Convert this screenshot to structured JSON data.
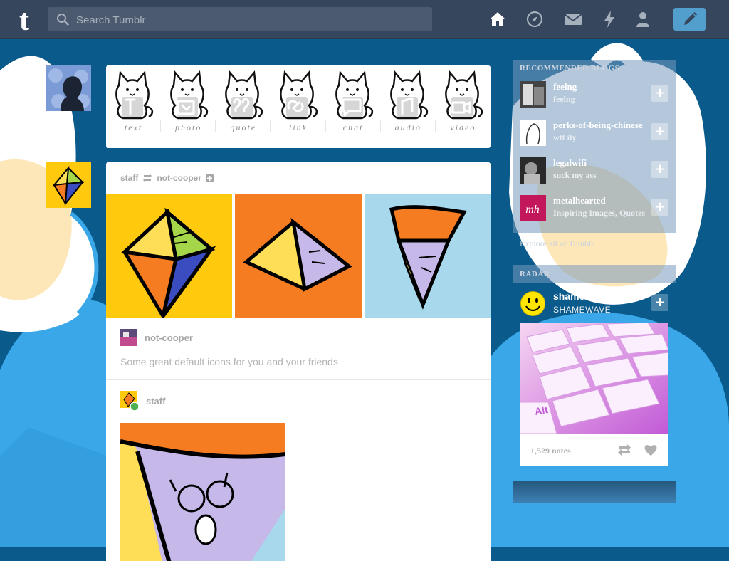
{
  "header": {
    "logo_text": "t",
    "search_placeholder": "Search Tumblr",
    "nav_icons": [
      "home-icon",
      "compass-icon",
      "mail-icon",
      "lightning-icon",
      "account-icon"
    ],
    "compose_icon": "pencil-icon",
    "accent": "#529ecc",
    "bar_color": "#36465d"
  },
  "composer": {
    "types": [
      {
        "label": "text"
      },
      {
        "label": "photo"
      },
      {
        "label": "quote"
      },
      {
        "label": "link"
      },
      {
        "label": "chat"
      },
      {
        "label": "audio"
      },
      {
        "label": "video"
      }
    ]
  },
  "post": {
    "header_user": "staff",
    "header_reblog_from": "not-cooper",
    "reblog_user": "not-cooper",
    "caption": "Some great default icons for you and your friends",
    "second_user": "staff"
  },
  "sidebar": {
    "recommended_title": "RECOMMENDED BLOGS",
    "recommended": [
      {
        "name": "feelng",
        "title": "feelng"
      },
      {
        "name": "perks-of-being-chinese",
        "title": "wtf ily"
      },
      {
        "name": "legalwifi",
        "title": "suck my ass"
      },
      {
        "name": "metalhearted",
        "title": "Inspiring Images, Quotes"
      }
    ],
    "explore": "Explore all of Tumblr",
    "radar_title": "RADAR",
    "radar_user": "shamewave",
    "radar_user_title": "SHAMEWAVE",
    "radar_notes": "1,529 notes",
    "radar_image_key": "Alt"
  }
}
